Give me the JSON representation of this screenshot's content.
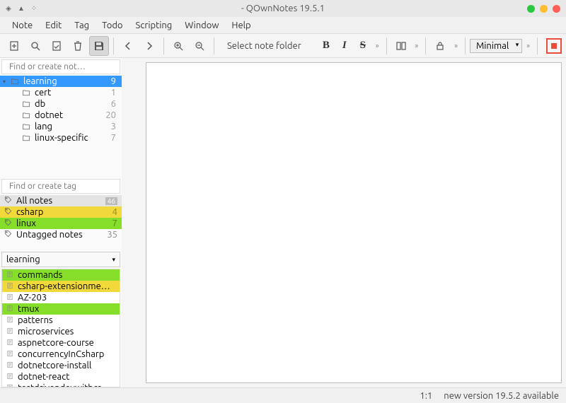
{
  "window": {
    "title": "- QOwnNotes 19.5.1"
  },
  "menu": {
    "items": [
      "Note",
      "Edit",
      "Tag",
      "Todo",
      "Scripting",
      "Window",
      "Help"
    ]
  },
  "toolbar": {
    "folder_select": "Select note folder",
    "minimal": "Minimal"
  },
  "sidebar": {
    "folder_search_placeholder": "Find or create not…",
    "tag_search_placeholder": "Find or create tag",
    "folders": [
      {
        "name": "learning",
        "count": 9,
        "selected": true,
        "depth": 0
      },
      {
        "name": "cert",
        "count": 1,
        "depth": 1
      },
      {
        "name": "db",
        "count": 6,
        "depth": 1
      },
      {
        "name": "dotnet",
        "count": 20,
        "depth": 1
      },
      {
        "name": "lang",
        "count": 3,
        "depth": 1
      },
      {
        "name": "linux-specific",
        "count": 7,
        "depth": 1
      }
    ],
    "tags": [
      {
        "name": "All notes",
        "count": 46,
        "class": "all"
      },
      {
        "name": "csharp",
        "count": 4,
        "class": "yellow"
      },
      {
        "name": "linux",
        "count": 7,
        "class": "green"
      },
      {
        "name": "Untagged notes",
        "count": 35,
        "class": ""
      }
    ],
    "dropdown": "learning",
    "notes": [
      {
        "name": "commands",
        "class": "green"
      },
      {
        "name": "csharp-extensionme…",
        "class": "yellow"
      },
      {
        "name": "AZ-203",
        "class": ""
      },
      {
        "name": "tmux",
        "class": "green"
      },
      {
        "name": "patterns",
        "class": ""
      },
      {
        "name": "microservices",
        "class": ""
      },
      {
        "name": "aspnetcore-course",
        "class": ""
      },
      {
        "name": "concurrencyInCsharp",
        "class": ""
      },
      {
        "name": "dotnetcore-install",
        "class": ""
      },
      {
        "name": "dotnet-react",
        "class": ""
      },
      {
        "name": "testdrivendevwithcs…",
        "class": ""
      }
    ]
  },
  "status": {
    "cursor": "1:1",
    "update": "new version 19.5.2 available"
  }
}
